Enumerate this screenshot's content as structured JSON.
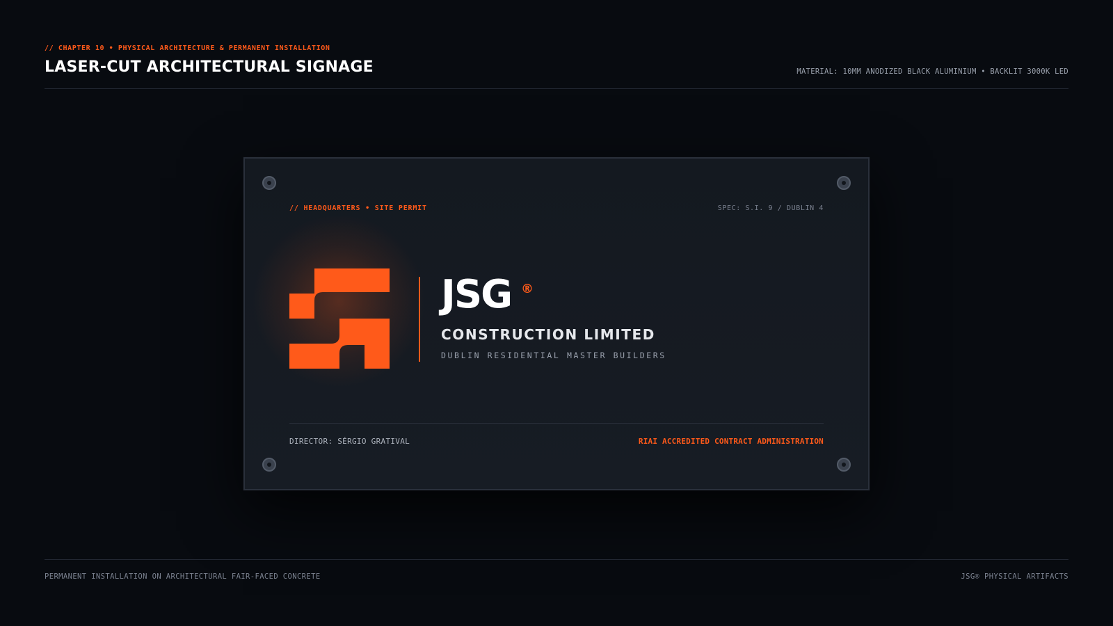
{
  "header": {
    "chapter": "// CHAPTER 10 • PHYSICAL ARCHITECTURE & PERMANENT INSTALLATION",
    "title": "LASER-CUT ARCHITECTURAL SIGNAGE",
    "material": "MATERIAL: 10MM ANODIZED BLACK ALUMINIUM • BACKLIT 3000K LED"
  },
  "plate": {
    "top_left": "// HEADQUARTERS • SITE PERMIT",
    "top_right": "SPEC: S.I. 9 / DUBLIN 4",
    "logo_icon": "jsg-monogram-icon",
    "brand": "JSG",
    "registered": "®",
    "company": "CONSTRUCTION LIMITED",
    "tagline": "DUBLIN RESIDENTIAL MASTER BUILDERS",
    "director": "DIRECTOR: SÉRGIO GRATIVAL",
    "accreditation": "RIAI ACCREDITED CONTRACT ADMINISTRATION"
  },
  "footer": {
    "left": "PERMANENT INSTALLATION ON ARCHITECTURAL FAIR-FACED CONCRETE",
    "right": "JSG® PHYSICAL ARTIFACTS"
  },
  "colors": {
    "accent": "#ff5a1a",
    "background": "#080b10",
    "plate": "#151a21"
  }
}
